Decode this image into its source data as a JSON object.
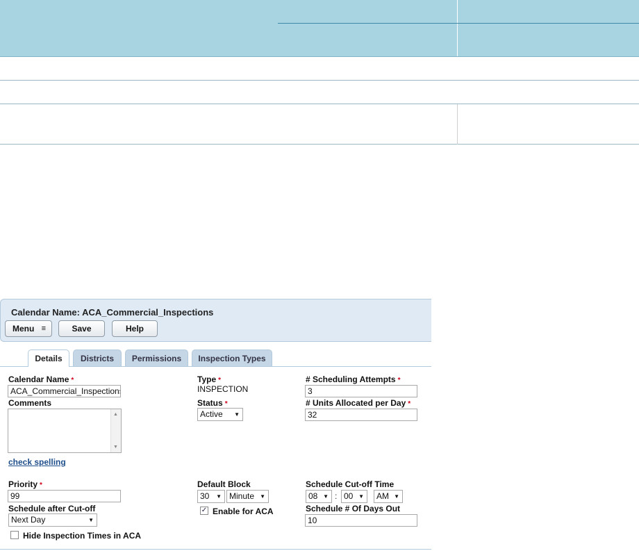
{
  "calendar": {
    "title": "Calendar Name: ACA_Commercial_Inspections",
    "toolbar": {
      "menu_label": "Menu",
      "save_label": "Save",
      "help_label": "Help"
    },
    "tabs": [
      {
        "label": "Details"
      },
      {
        "label": "Districts"
      },
      {
        "label": "Permissions"
      },
      {
        "label": "Inspection Types"
      }
    ],
    "form": {
      "calendar_name_label": "Calendar Name",
      "calendar_name_value": "ACA_Commercial_Inspections",
      "comments_label": "Comments",
      "check_spelling": "check spelling",
      "type_label": "Type",
      "type_value": "INSPECTION",
      "status_label": "Status",
      "status_value": "Active",
      "scheduling_attempts_label": "# Scheduling Attempts",
      "scheduling_attempts_value": "3",
      "units_per_day_label": "# Units Allocated per Day",
      "units_per_day_value": "32",
      "priority_label": "Priority",
      "priority_value": "99",
      "schedule_after_cutoff_label": "Schedule after Cut-off",
      "schedule_after_cutoff_value": "Next Day",
      "hide_times_label": "Hide Inspection Times in ACA",
      "default_block_label": "Default Block",
      "default_block_value": "30",
      "default_block_unit": "Minute",
      "enable_aca_label": "Enable for ACA",
      "cutoff_time_label": "Schedule Cut-off Time",
      "cutoff_hour": "08",
      "cutoff_minute": "00",
      "cutoff_ampm": "AM",
      "cutoff_separator": ":",
      "days_out_label": "Schedule # Of Days Out",
      "days_out_value": "10",
      "required_mark": "*"
    }
  }
}
